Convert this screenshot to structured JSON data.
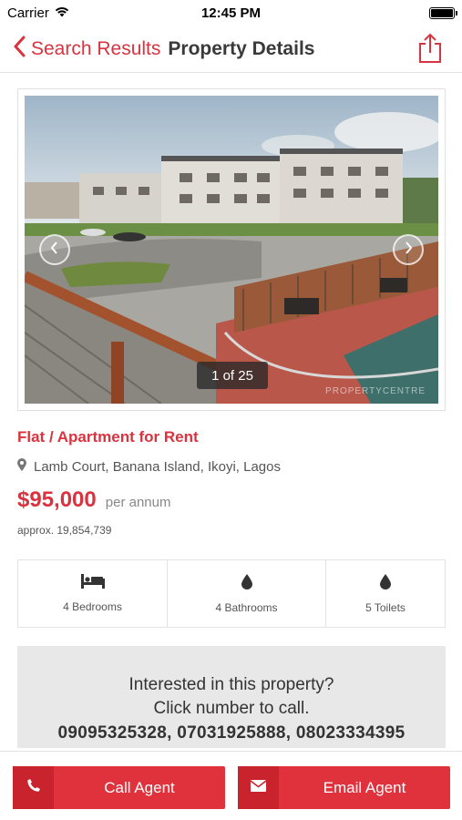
{
  "status_bar": {
    "carrier": "Carrier",
    "time": "12:45 PM"
  },
  "nav": {
    "back_label": "Search Results",
    "title": "Property Details"
  },
  "gallery": {
    "counter": "1 of 25",
    "watermark": "PROPERTYCENTRE"
  },
  "listing": {
    "title": "Flat / Apartment for Rent",
    "address": "Lamb Court, Banana Island, Ikoyi, Lagos",
    "price": "$95,000",
    "period": "per annum",
    "approx": "approx. 19,854,739"
  },
  "features": [
    {
      "icon": "bed-icon",
      "label": "4 Bedrooms"
    },
    {
      "icon": "water-drop-icon",
      "label": "4 Bathrooms"
    },
    {
      "icon": "water-drop-icon",
      "label": "5 Toilets"
    }
  ],
  "contact": {
    "line1": "Interested in this property?",
    "line2": "Click number to call.",
    "phones": "09095325328, 07031925888, 08023334395"
  },
  "actions": {
    "call_label": "Call Agent",
    "email_label": "Email Agent"
  },
  "colors": {
    "accent": "#d9333f",
    "button": "#e0323c",
    "button_icon_bg": "#c9242e",
    "contact_bg": "#e8e8e8"
  }
}
